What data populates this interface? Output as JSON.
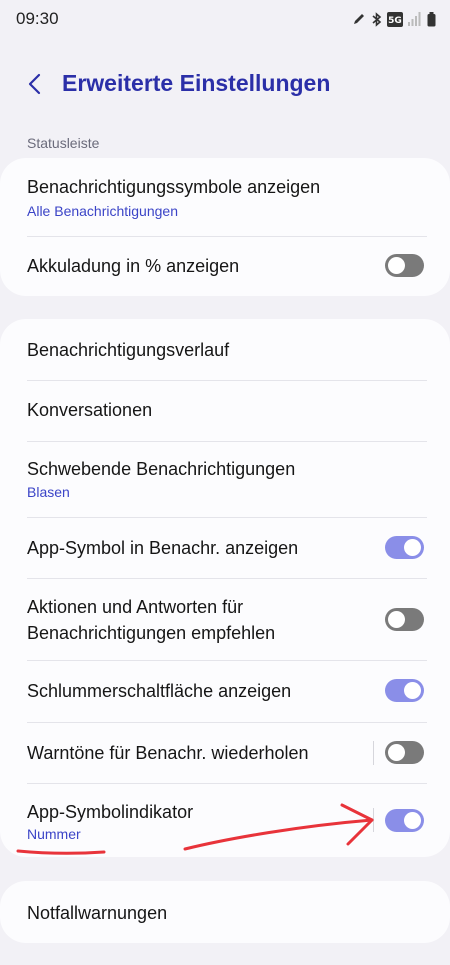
{
  "status_bar": {
    "time": "09:30",
    "icons": [
      "pen-icon",
      "bluetooth-icon",
      "5g-icon",
      "signal-icon",
      "battery-icon"
    ],
    "network_badge": "5G"
  },
  "header": {
    "title": "Erweiterte Einstellungen",
    "back_icon": "chevron-left-icon"
  },
  "section": {
    "label": "Statusleiste"
  },
  "card1": {
    "rows": [
      {
        "label": "Benachrichtigungssymbole anzeigen",
        "sub": "Alle Benachrichtigungen"
      },
      {
        "label": "Akkuladung in % anzeigen",
        "toggle": false
      }
    ]
  },
  "card2": {
    "rows": [
      {
        "label": "Benachrichtigungsverlauf"
      },
      {
        "label": "Konversationen"
      },
      {
        "label": "Schwebende Benachrichtigungen",
        "sub": "Blasen"
      },
      {
        "label": "App-Symbol in Benachr. anzeigen",
        "toggle": true
      },
      {
        "label": "Aktionen und Antworten für",
        "label2": "Benachrichtigungen empfehlen",
        "toggle": false
      },
      {
        "label": "Schlummerschaltfläche anzeigen",
        "toggle": true
      },
      {
        "label": "Warntöne für Benachr. wiederholen",
        "toggle": false
      },
      {
        "label": "App-Symbolindikator",
        "sub": "Nummer",
        "toggle": true
      }
    ]
  },
  "card3": {
    "rows": [
      {
        "label": "Notfallwarnungen"
      }
    ]
  },
  "colors": {
    "accent_title": "#2b2fa8",
    "accent_sub": "#3b44c7",
    "toggle_on": "#8a8ee8",
    "toggle_off": "#7a7a7a",
    "annotation": "#e8333a",
    "background": "#f2f1f6"
  }
}
